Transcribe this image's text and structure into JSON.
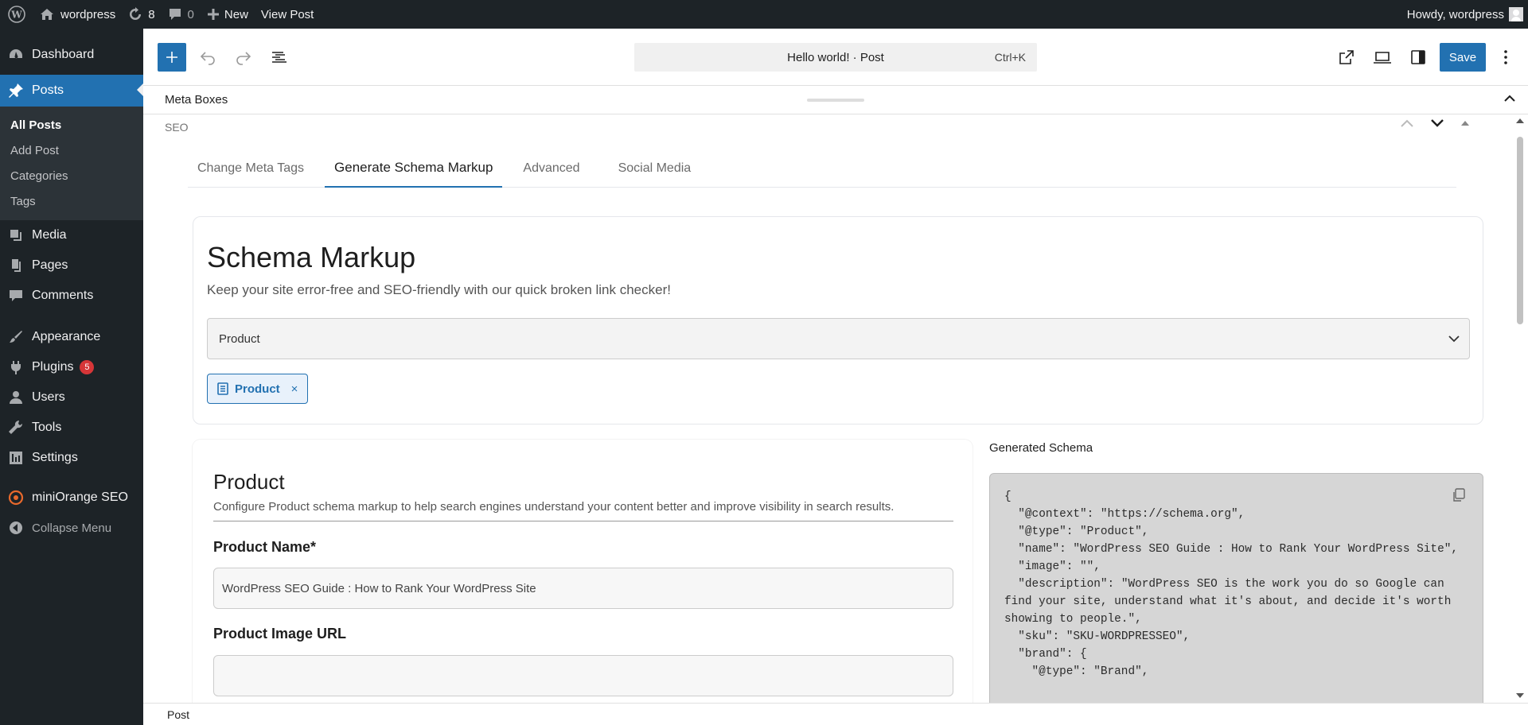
{
  "adminbar": {
    "site_name": "wordpress",
    "updates_count": "8",
    "comments_count": "0",
    "new_label": "New",
    "view_post_label": "View Post",
    "howdy": "Howdy, wordpress"
  },
  "sidebar": {
    "dashboard": "Dashboard",
    "posts": "Posts",
    "sub_all_posts": "All Posts",
    "sub_add_post": "Add Post",
    "sub_categories": "Categories",
    "sub_tags": "Tags",
    "media": "Media",
    "pages": "Pages",
    "comments": "Comments",
    "appearance": "Appearance",
    "plugins": "Plugins",
    "plugins_badge": "5",
    "users": "Users",
    "tools": "Tools",
    "settings": "Settings",
    "miniorange": "miniOrange SEO",
    "collapse": "Collapse Menu"
  },
  "editor": {
    "command_title": "Hello world! · Post",
    "command_shortcut": "Ctrl+K",
    "save_label": "Save"
  },
  "metabar": {
    "title": "Meta Boxes"
  },
  "seo": {
    "label": "SEO",
    "tabs": [
      "Change Meta Tags",
      "Generate Schema Markup",
      "Advanced",
      "Social Media"
    ],
    "active_tab": "Generate Schema Markup",
    "schema_title": "Schema Markup",
    "schema_subtitle": "Keep your site error-free and SEO-friendly with our quick broken link checker!",
    "select_value": "Product",
    "chip_label": "Product",
    "chip_remove": "×"
  },
  "product": {
    "title": "Product",
    "description": "Configure Product schema markup to help search engines understand your content better and improve visibility in search results.",
    "name_label": "Product Name*",
    "name_value": "WordPress SEO Guide : How to Rank Your WordPress Site",
    "image_label": "Product Image URL",
    "image_value": ""
  },
  "generated": {
    "label": "Generated Schema",
    "code": "{\n  \"@context\": \"https://schema.org\",\n  \"@type\": \"Product\",\n  \"name\": \"WordPress SEO Guide : How to Rank Your WordPress Site\",\n  \"image\": \"\",\n  \"description\": \"WordPress SEO is the work you do so Google can find your site, understand what it's about, and decide it's worth showing to people.\",\n  \"sku\": \"SKU-WORDPRESSEO\",\n  \"brand\": {\n    \"@type\": \"Brand\","
  },
  "footer": {
    "breadcrumb": "Post"
  },
  "colors": {
    "accent": "#2271b1",
    "admin_dark": "#1d2327"
  }
}
